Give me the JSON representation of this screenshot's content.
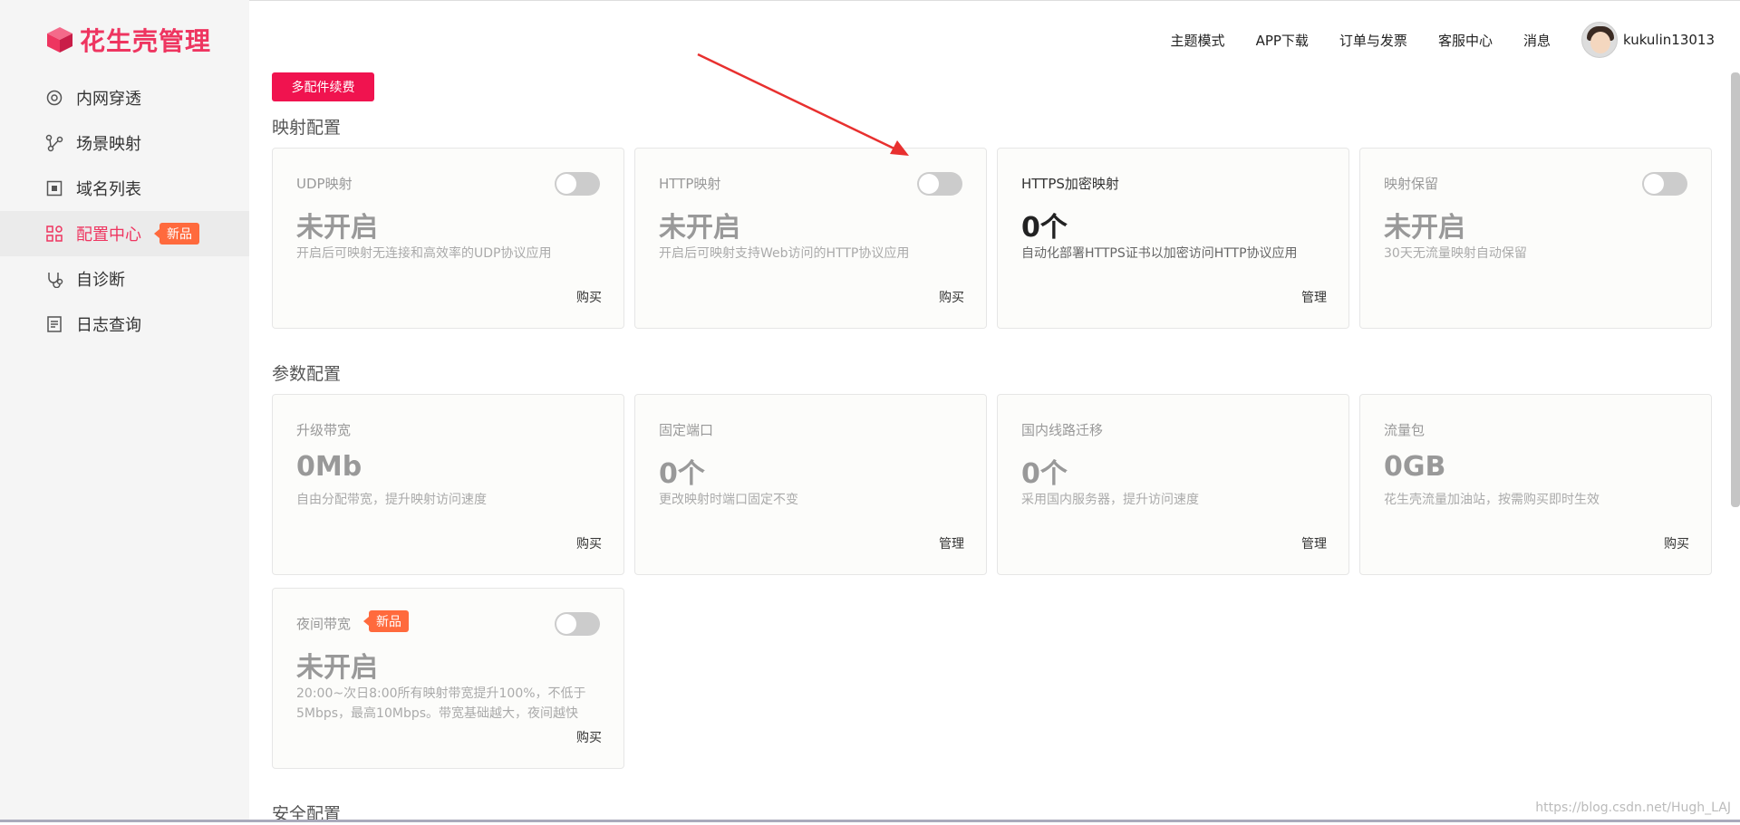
{
  "app": {
    "logo_text": "花生壳管理",
    "brand_color": "#ee3560"
  },
  "sidebar": {
    "items": [
      {
        "label": "内网穿透",
        "icon": "network-icon"
      },
      {
        "label": "场景映射",
        "icon": "scene-map-icon"
      },
      {
        "label": "域名列表",
        "icon": "domain-list-icon"
      },
      {
        "label": "配置中心",
        "icon": "config-center-icon",
        "active": true,
        "badge": "新品"
      },
      {
        "label": "自诊断",
        "icon": "self-diagnose-icon"
      },
      {
        "label": "日志查询",
        "icon": "log-query-icon"
      }
    ]
  },
  "topnav": {
    "theme": "主题模式",
    "app_download": "APP下载",
    "orders": "订单与发票",
    "support": "客服中心",
    "messages": "消息",
    "username": "kukulin13013"
  },
  "main": {
    "renew_button": "多配件续费",
    "sections": {
      "mapping": "映射配置",
      "params": "参数配置",
      "security": "安全配置"
    },
    "mapping_cards": [
      {
        "title": "UDP映射",
        "value": "未开启",
        "desc": "开启后可映射无连接和高效率的UDP协议应用",
        "action": "购买",
        "toggle": "off"
      },
      {
        "title": "HTTP映射",
        "value": "未开启",
        "desc": "开启后可映射支持Web访问的HTTP协议应用",
        "action": "购买",
        "toggle": "off"
      },
      {
        "title": "HTTPS加密映射",
        "value": "0个",
        "desc": "自动化部署HTTPS证书以加密访问HTTP协议应用",
        "action": "管理"
      },
      {
        "title": "映射保留",
        "value": "未开启",
        "desc": "30天无流量映射自动保留",
        "action": "",
        "toggle": "off"
      }
    ],
    "param_cards": [
      {
        "title": "升级带宽",
        "value": "0Mb",
        "desc": "自由分配带宽，提升映射访问速度",
        "action": "购买"
      },
      {
        "title": "固定端口",
        "value": "0个",
        "desc": "更改映射时端口固定不变",
        "action": "管理"
      },
      {
        "title": "国内线路迁移",
        "value": "0个",
        "desc": "采用国内服务器，提升访问速度",
        "action": "管理"
      },
      {
        "title": "流量包",
        "value": "0GB",
        "desc": "花生壳流量加油站，按需购买即时生效",
        "action": "购买"
      }
    ],
    "night_card": {
      "title": "夜间带宽",
      "badge": "新品",
      "value": "未开启",
      "desc": "20:00~次日8:00所有映射带宽提升100%，不低于5Mbps，最高10Mbps。带宽基础越大，夜间越快",
      "action": "购买",
      "toggle": "off"
    }
  },
  "watermark": "https://blog.csdn.net/Hugh_LAJ"
}
